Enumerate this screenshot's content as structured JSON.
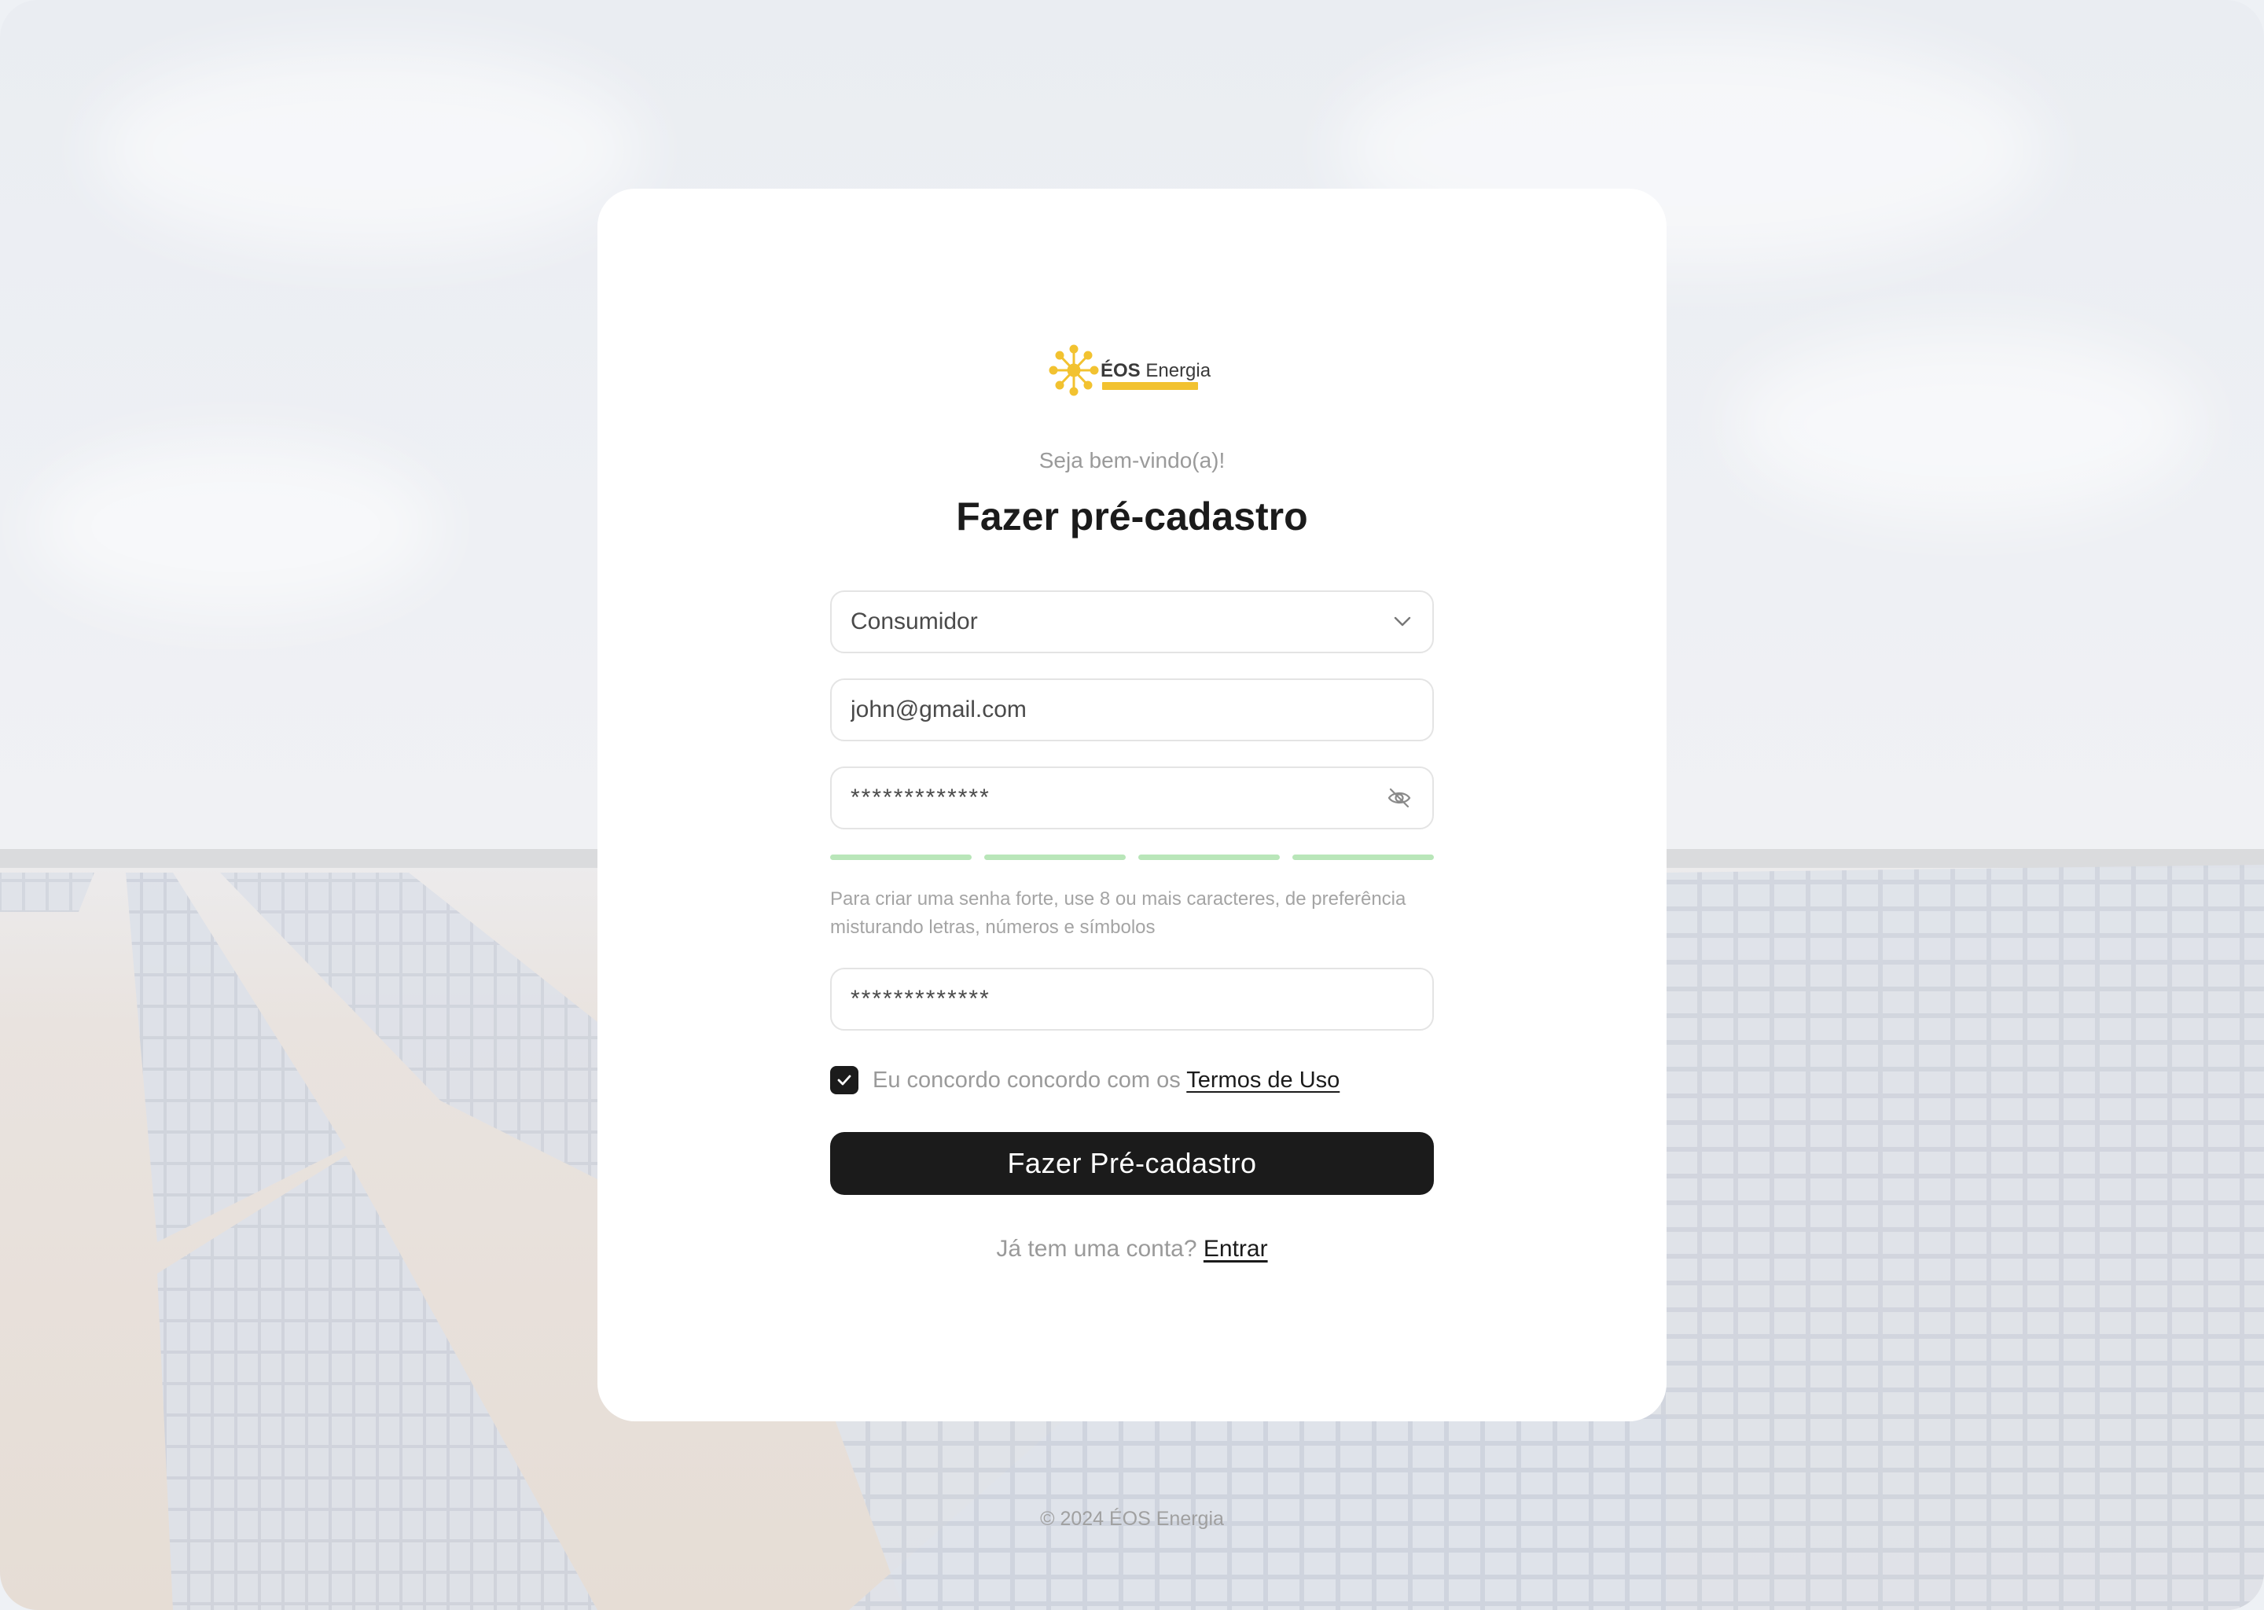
{
  "brand": {
    "name_bold": "ÉOS",
    "name_regular": "Energia",
    "accent_color": "#f2c230"
  },
  "welcome": "Seja bem-vindo(a)!",
  "title": "Fazer pré-cadastro",
  "form": {
    "account_type": {
      "value": "Consumidor",
      "icon": "chevron-down-icon"
    },
    "email": {
      "value": "john@gmail.com"
    },
    "password": {
      "value": "*************",
      "icon": "eye-off-icon"
    },
    "password_strength": {
      "filled_segments": 4,
      "total_segments": 4,
      "color": "#b9e6b9"
    },
    "password_hint": "Para criar uma senha forte, use 8 ou mais caracteres, de preferência misturando letras, números e símbolos",
    "confirm_password": {
      "value": "*************"
    },
    "terms": {
      "checked": true,
      "text": "Eu concordo concordo com os",
      "link": "Termos de Uso"
    },
    "submit_label": "Fazer Pré-cadastro"
  },
  "login_prompt": {
    "text": "Já tem uma conta?",
    "link": "Entrar"
  },
  "footer": "© 2024 ÉOS Energia"
}
